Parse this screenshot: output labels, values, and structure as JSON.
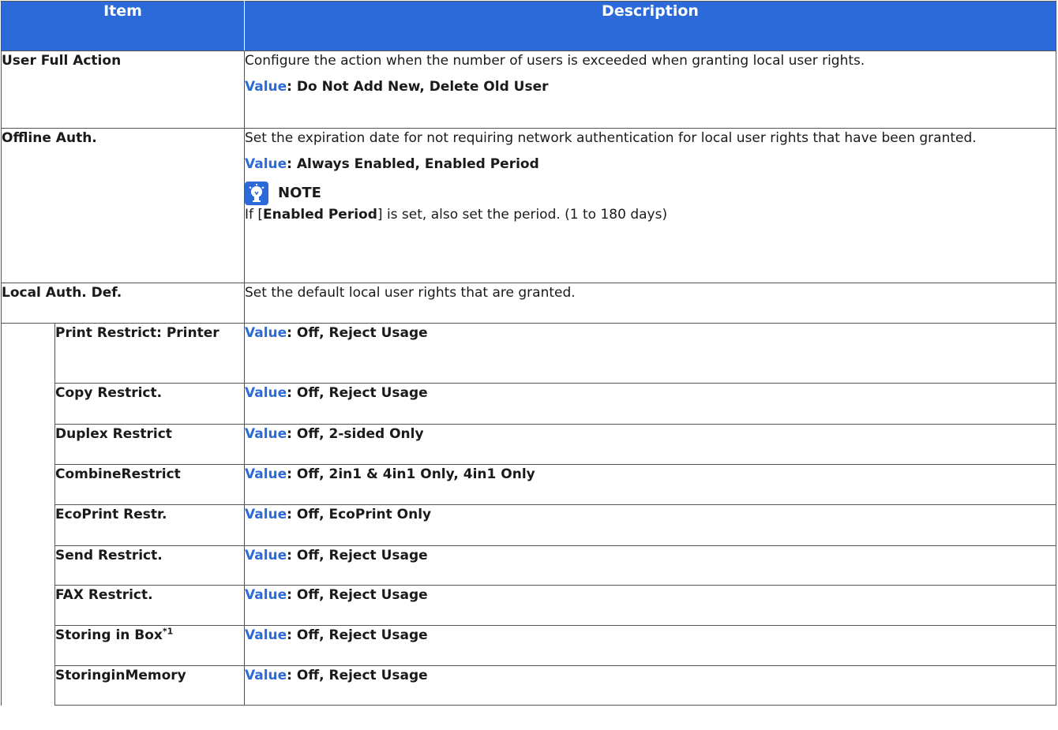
{
  "header": {
    "item": "Item",
    "description": "Description"
  },
  "value_label": "Value",
  "rows": {
    "user_full_action": {
      "item": "User Full Action",
      "desc": "Configure the action when the number of users is exceeded when granting local user rights.",
      "value": ": Do Not Add New, Delete Old User"
    },
    "offline_auth": {
      "item": "Offline Auth.",
      "desc": "Set the expiration date for not requiring network authentication for local user rights that have been granted.",
      "value": ": Always Enabled, Enabled Period",
      "note_title": "NOTE",
      "note_pre": "If [",
      "note_bold": "Enabled Period",
      "note_post": "] is set, also set the period. (1 to 180 days)"
    },
    "local_auth_def": {
      "item": "Local Auth. Def.",
      "desc": "Set the default local user rights that are granted."
    }
  },
  "sub_rows": [
    {
      "item": "Print Restrict: Printer",
      "value": ": Off, Reject Usage"
    },
    {
      "item": "Copy Restrict.",
      "value": ": Off, Reject Usage"
    },
    {
      "item": "Duplex Restrict",
      "value": ": Off, 2-sided Only"
    },
    {
      "item": "CombineRestrict",
      "value": ": Off, 2in1 & 4in1 Only, 4in1 Only"
    },
    {
      "item": "EcoPrint Restr.",
      "value": ": Off, EcoPrint Only"
    },
    {
      "item": "Send Restrict.",
      "value": ": Off, Reject Usage"
    },
    {
      "item": "FAX Restrict.",
      "value": ": Off, Reject Usage"
    },
    {
      "item": "Storing in Box",
      "sup": "*1",
      "value": ": Off, Reject Usage"
    },
    {
      "item": "StoringinMemory",
      "value": ": Off, Reject Usage"
    }
  ],
  "colors": {
    "header_bg": "#2b6ad8",
    "value_label": "#2b6ad8",
    "border": "#555555"
  },
  "icons": {
    "note": "note-lightbulb-icon"
  }
}
